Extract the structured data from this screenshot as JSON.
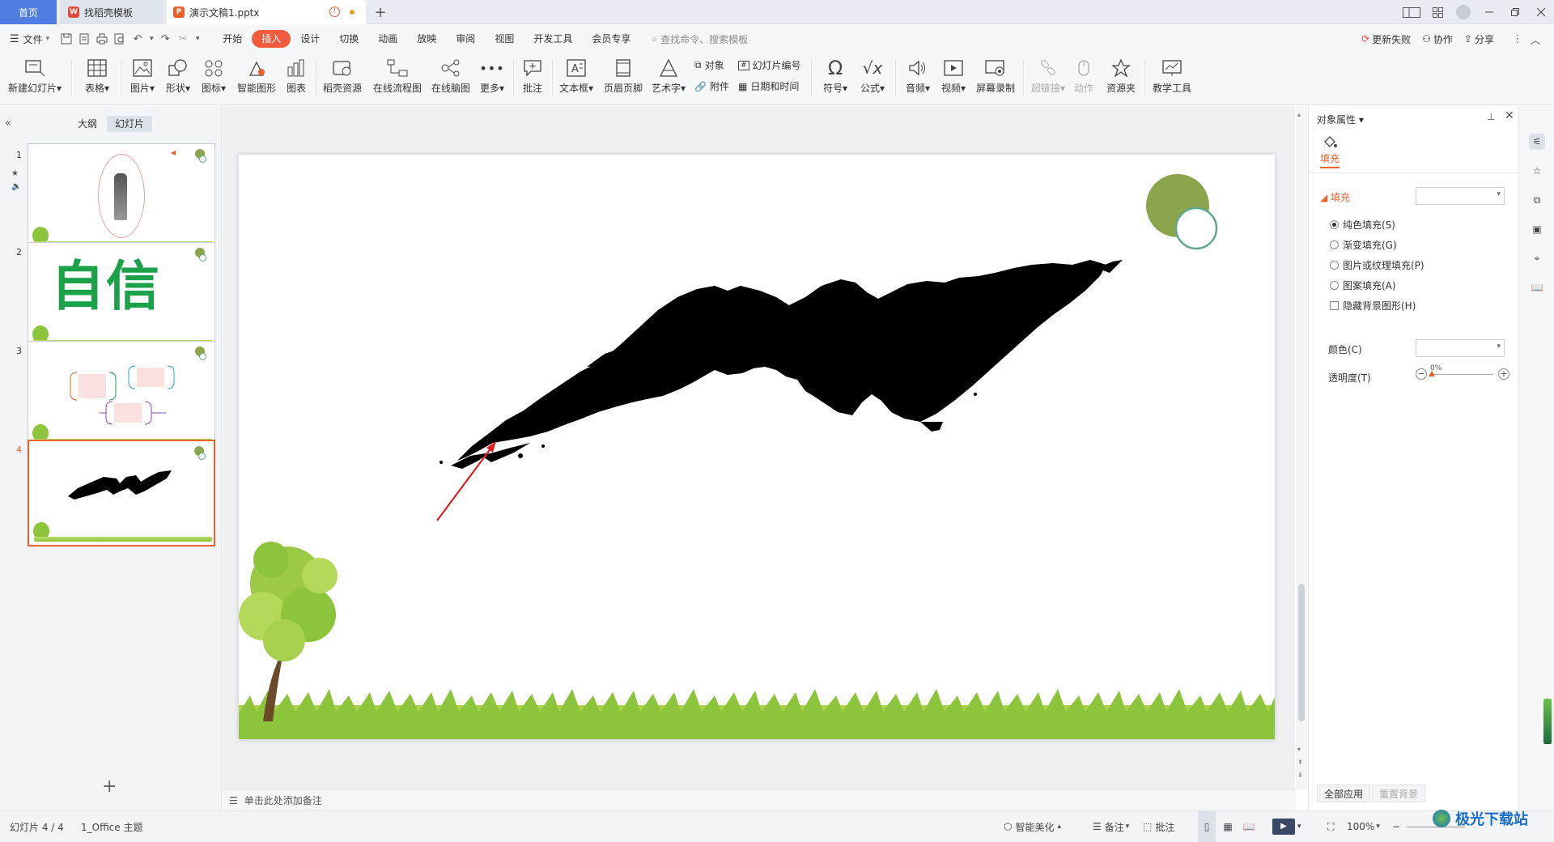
{
  "tabs": {
    "home": "首页",
    "docer": "找稻壳模板",
    "document": "演示文稿1.pptx",
    "new_tab": "+"
  },
  "menu": {
    "file": "文件",
    "items": [
      "开始",
      "插入",
      "设计",
      "切换",
      "动画",
      "放映",
      "审阅",
      "视图",
      "开发工具",
      "会员专享"
    ],
    "active": "插入",
    "search_placeholder": "查找命令、搜索模板",
    "update_failed": "更新失败",
    "collaborate": "协作",
    "share": "分享"
  },
  "ribbon": {
    "new_slide": "新建幻灯片",
    "table": "表格",
    "picture": "图片",
    "shape": "形状",
    "icon": "图标",
    "smart_shape": "智能图形",
    "chart": "图表",
    "docer_resource": "稻壳资源",
    "online_flowchart": "在线流程图",
    "online_mindmap": "在线脑图",
    "more": "更多",
    "comment": "批注",
    "textbox": "文本框",
    "header_footer": "页眉页脚",
    "wordart": "艺术字",
    "object": "对象",
    "slide_number": "幻灯片编号",
    "attachment": "附件",
    "date_time": "日期和时间",
    "symbol": "符号",
    "formula": "公式",
    "audio": "音频",
    "video": "视频",
    "screen_record": "屏幕录制",
    "hyperlink": "超链接",
    "action": "动作",
    "resource_folder": "资源夹",
    "teaching_tools": "教学工具"
  },
  "left_pane": {
    "outline_tab": "大纲",
    "slides_tab": "幻灯片",
    "slide_numbers": [
      "1",
      "2",
      "3",
      "4"
    ],
    "selected_slide": 4,
    "slide2_text": "自信",
    "add_slide": "+"
  },
  "notes_placeholder": "单击此处添加备注",
  "right_panel": {
    "title": "对象属性",
    "tab_fill": "填充",
    "section_fill": "填充",
    "fill_options": [
      "纯色填充(S)",
      "渐变填充(G)",
      "图片或纹理填充(P)",
      "图案填充(A)"
    ],
    "selected_fill": "纯色填充(S)",
    "hide_bg_shapes": "隐藏背景图形(H)",
    "color_label": "颜色(C)",
    "transparency_label": "透明度(T)",
    "transparency_value": "0%",
    "apply_all": "全部应用",
    "reset_bg": "重置背景"
  },
  "status": {
    "slide_indicator": "幻灯片 4 / 4",
    "theme": "1_Office 主题",
    "smart_beautify": "智能美化",
    "notes": "备注",
    "comments": "批注",
    "zoom": "100%"
  },
  "watermark": "极光下载站",
  "colors": {
    "accent": "#f05b3e",
    "home_tab": "#4f7de2",
    "selected_thumb_border": "#e8622c",
    "circle_fill": "#8aa54c",
    "circle_ring": "#5fa88f",
    "arrow": "#e02020"
  }
}
